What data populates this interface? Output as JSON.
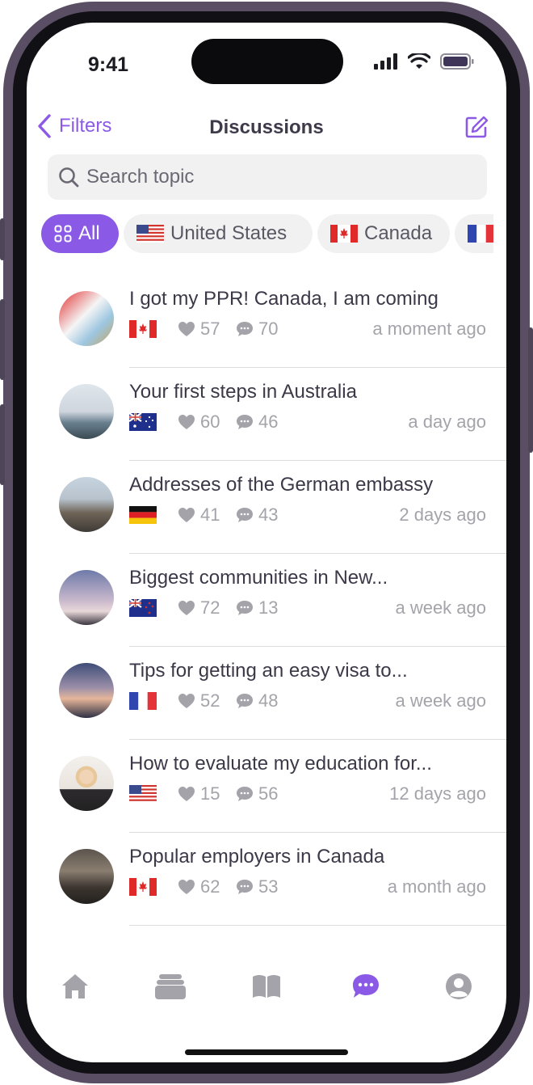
{
  "status": {
    "time": "9:41"
  },
  "nav": {
    "back_label": "Filters",
    "title": "Discussions"
  },
  "search": {
    "placeholder": "Search topic"
  },
  "chips": [
    {
      "label": "All",
      "icon": "grid-icon",
      "active": true
    },
    {
      "label": "United States",
      "flag": "us"
    },
    {
      "label": "Canada",
      "flag": "ca"
    },
    {
      "label": "",
      "flag": "fr"
    }
  ],
  "discussions": [
    {
      "title": "I got my PPR! Canada, I am coming",
      "flag": "ca",
      "likes": "57",
      "comments": "70",
      "ago": "a moment ago",
      "avatar": "canada-flag-photo"
    },
    {
      "title": "Your first steps in Australia",
      "flag": "au",
      "likes": "60",
      "comments": "46",
      "ago": "a day ago",
      "avatar": "sydney-opera-house-photo"
    },
    {
      "title": "Addresses of the German embassy",
      "flag": "de",
      "likes": "41",
      "comments": "43",
      "ago": "2 days ago",
      "avatar": "brandenburg-gate-photo"
    },
    {
      "title": "Biggest communities in New...",
      "flag": "nz",
      "likes": "72",
      "comments": "13",
      "ago": "a week ago",
      "avatar": "sky-tower-photo"
    },
    {
      "title": "Tips for getting an easy visa to...",
      "flag": "fr",
      "likes": "52",
      "comments": "48",
      "ago": "a week ago",
      "avatar": "eiffel-tower-photo"
    },
    {
      "title": "How to evaluate my education for...",
      "flag": "us",
      "likes": "15",
      "comments": "56",
      "ago": "12 days ago",
      "avatar": "woman-at-desk-photo"
    },
    {
      "title": "Popular employers in Canada",
      "flag": "ca",
      "likes": "62",
      "comments": "53",
      "ago": "a month ago",
      "avatar": "office-people-photo"
    }
  ],
  "tabbar": [
    "home-icon",
    "jobs-icon",
    "guides-icon",
    "discussions-icon",
    "profile-icon"
  ],
  "colors": {
    "accent": "#8a5ae6",
    "text": "#3c3848",
    "muted": "#a5a3aa"
  }
}
